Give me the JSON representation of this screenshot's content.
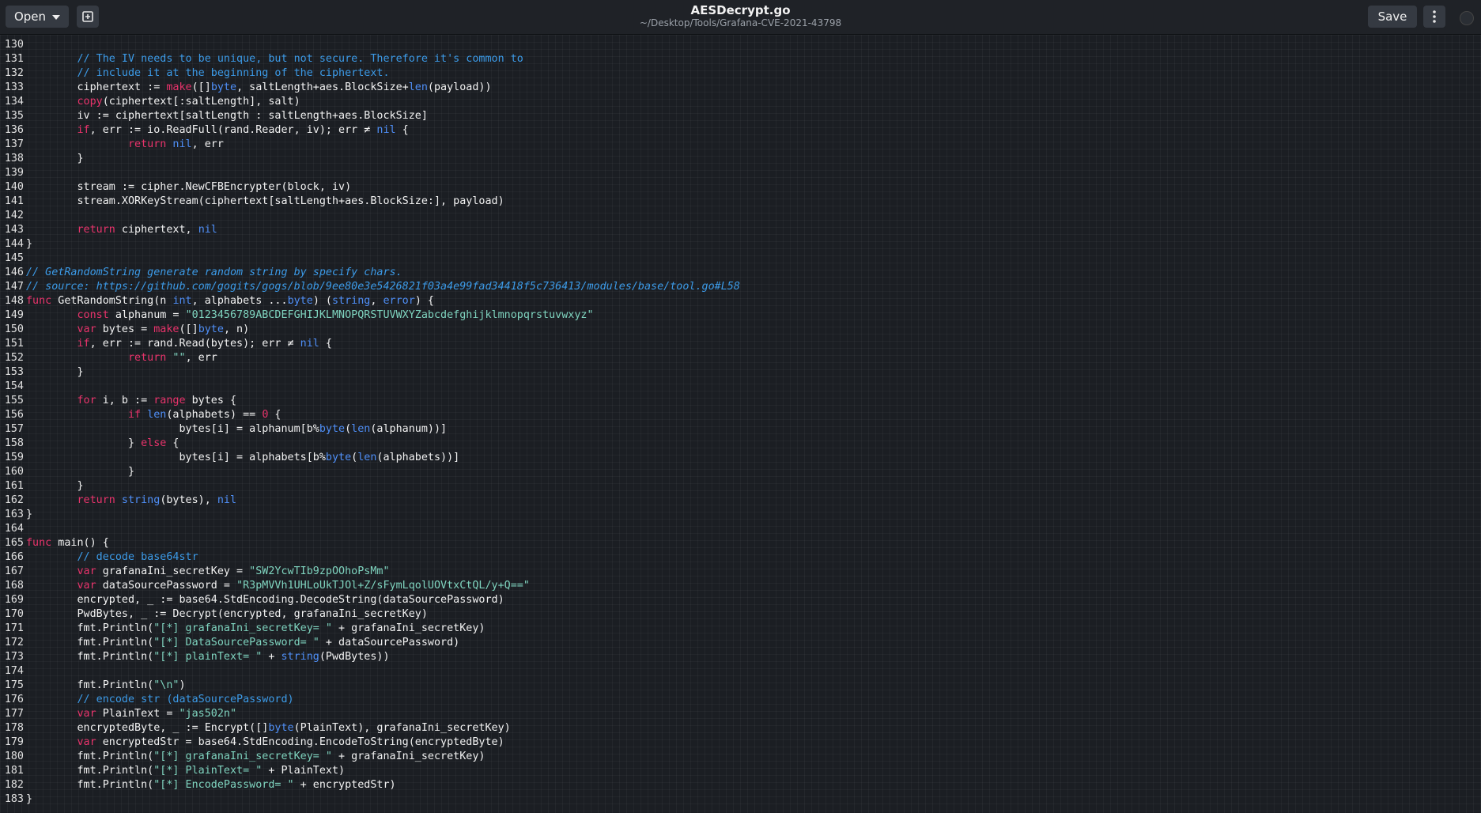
{
  "header": {
    "open_label": "Open",
    "title": "AESDecrypt.go",
    "path": "~/Desktop/Tools/Grafana-CVE-2021-43798",
    "save_label": "Save"
  },
  "icons": {
    "new_document": "new-document-icon",
    "menu": "vertical-ellipsis-icon",
    "dropdown": "chevron-down-icon"
  },
  "colors": {
    "background": "#1b1e23",
    "keyword": "#e8336b",
    "type": "#4f8ff7",
    "string": "#7fd4bf",
    "comment": "#3c9be8"
  },
  "code_lines": [
    {
      "n": "130",
      "t": []
    },
    {
      "n": "131",
      "t": [
        [
          "cm",
          "\t// The IV needs to be unique, but not secure. Therefore it's common to"
        ]
      ]
    },
    {
      "n": "132",
      "t": [
        [
          "cm",
          "\t// include it at the beginning of the ciphertext."
        ]
      ]
    },
    {
      "n": "133",
      "t": [
        [
          "",
          "\tciphertext := "
        ],
        [
          "fn",
          "make"
        ],
        [
          "",
          "([]"
        ],
        [
          "ty",
          "byte"
        ],
        [
          "",
          ", saltLength+aes.BlockSize+"
        ],
        [
          "ty",
          "len"
        ],
        [
          "",
          "(payload))"
        ]
      ]
    },
    {
      "n": "134",
      "t": [
        [
          "",
          "\t"
        ],
        [
          "fn",
          "copy"
        ],
        [
          "",
          "(ciphertext[:saltLength], salt)"
        ]
      ]
    },
    {
      "n": "135",
      "t": [
        [
          "",
          "\tiv := ciphertext[saltLength : saltLength+aes.BlockSize]"
        ]
      ]
    },
    {
      "n": "136",
      "t": [
        [
          "kw",
          "\tif"
        ],
        [
          "",
          ", err := io.ReadFull(rand.Reader, iv); err ≠ "
        ],
        [
          "ty",
          "nil"
        ],
        [
          "",
          " {"
        ]
      ]
    },
    {
      "n": "137",
      "t": [
        [
          "kw",
          "\t\treturn"
        ],
        [
          "ty",
          " nil"
        ],
        [
          "",
          ", err"
        ]
      ]
    },
    {
      "n": "138",
      "t": [
        [
          "",
          "\t}"
        ]
      ]
    },
    {
      "n": "139",
      "t": []
    },
    {
      "n": "140",
      "t": [
        [
          "",
          "\tstream := cipher.NewCFBEncrypter(block, iv)"
        ]
      ]
    },
    {
      "n": "141",
      "t": [
        [
          "",
          "\tstream.XORKeyStream(ciphertext[saltLength+aes.BlockSize:], payload)"
        ]
      ]
    },
    {
      "n": "142",
      "t": []
    },
    {
      "n": "143",
      "t": [
        [
          "kw",
          "\treturn"
        ],
        [
          "",
          " ciphertext, "
        ],
        [
          "ty",
          "nil"
        ]
      ]
    },
    {
      "n": "144",
      "t": [
        [
          "",
          "}"
        ]
      ]
    },
    {
      "n": "145",
      "t": []
    },
    {
      "n": "146",
      "t": [
        [
          "url",
          "// GetRandomString generate random string by specify chars."
        ]
      ]
    },
    {
      "n": "147",
      "t": [
        [
          "url",
          "// source: https://github.com/gogits/gogs/blob/9ee80e3e5426821f03a4e99fad34418f5c736413/modules/base/tool.go#L58"
        ]
      ]
    },
    {
      "n": "148",
      "t": [
        [
          "kw",
          "func"
        ],
        [
          "",
          " GetRandomString(n "
        ],
        [
          "ty",
          "int"
        ],
        [
          "",
          ", alphabets ..."
        ],
        [
          "ty",
          "byte"
        ],
        [
          "",
          ") ("
        ],
        [
          "ty",
          "string"
        ],
        [
          "",
          ", "
        ],
        [
          "ty",
          "error"
        ],
        [
          "",
          ") {"
        ]
      ]
    },
    {
      "n": "149",
      "t": [
        [
          "kw",
          "\tconst"
        ],
        [
          "",
          " alphanum = "
        ],
        [
          "str",
          "\"0123456789ABCDEFGHIJKLMNOPQRSTUVWXYZabcdefghijklmnopqrstuvwxyz\""
        ]
      ]
    },
    {
      "n": "150",
      "t": [
        [
          "kw",
          "\tvar"
        ],
        [
          "",
          " bytes = "
        ],
        [
          "fn",
          "make"
        ],
        [
          "",
          "([]"
        ],
        [
          "ty",
          "byte"
        ],
        [
          "",
          ", n)"
        ]
      ]
    },
    {
      "n": "151",
      "t": [
        [
          "kw",
          "\tif"
        ],
        [
          "",
          ", err := rand.Read(bytes); err ≠ "
        ],
        [
          "ty",
          "nil"
        ],
        [
          "",
          " {"
        ]
      ]
    },
    {
      "n": "152",
      "t": [
        [
          "kw",
          "\t\treturn"
        ],
        [
          "str",
          " \"\""
        ],
        [
          "",
          ", err"
        ]
      ]
    },
    {
      "n": "153",
      "t": [
        [
          "",
          "\t}"
        ]
      ]
    },
    {
      "n": "154",
      "t": []
    },
    {
      "n": "155",
      "t": [
        [
          "kw",
          "\tfor"
        ],
        [
          "",
          " i, b := "
        ],
        [
          "kw",
          "range"
        ],
        [
          "",
          " bytes {"
        ]
      ]
    },
    {
      "n": "156",
      "t": [
        [
          "kw",
          "\t\tif"
        ],
        [
          "ty",
          " len"
        ],
        [
          "",
          "(alphabets) == "
        ],
        [
          "kw",
          "0"
        ],
        [
          "",
          " {"
        ]
      ]
    },
    {
      "n": "157",
      "t": [
        [
          "",
          "\t\t\tbytes[i] = alphanum[b%"
        ],
        [
          "ty",
          "byte"
        ],
        [
          "",
          "("
        ],
        [
          "ty",
          "len"
        ],
        [
          "",
          "(alphanum))]"
        ]
      ]
    },
    {
      "n": "158",
      "t": [
        [
          "",
          "\t\t} "
        ],
        [
          "kw",
          "else"
        ],
        [
          "",
          " {"
        ]
      ]
    },
    {
      "n": "159",
      "t": [
        [
          "",
          "\t\t\tbytes[i] = alphabets[b%"
        ],
        [
          "ty",
          "byte"
        ],
        [
          "",
          "("
        ],
        [
          "ty",
          "len"
        ],
        [
          "",
          "(alphabets))]"
        ]
      ]
    },
    {
      "n": "160",
      "t": [
        [
          "",
          "\t\t}"
        ]
      ]
    },
    {
      "n": "161",
      "t": [
        [
          "",
          "\t}"
        ]
      ]
    },
    {
      "n": "162",
      "t": [
        [
          "kw",
          "\treturn"
        ],
        [
          "ty",
          " string"
        ],
        [
          "",
          "(bytes), "
        ],
        [
          "ty",
          "nil"
        ]
      ]
    },
    {
      "n": "163",
      "t": [
        [
          "",
          "}"
        ]
      ]
    },
    {
      "n": "164",
      "t": []
    },
    {
      "n": "165",
      "t": [
        [
          "kw",
          "func"
        ],
        [
          "",
          " main() {"
        ]
      ]
    },
    {
      "n": "166",
      "t": [
        [
          "cm",
          "\t// decode base64str"
        ]
      ]
    },
    {
      "n": "167",
      "t": [
        [
          "kw",
          "\tvar"
        ],
        [
          "",
          " grafanaIni_secretKey = "
        ],
        [
          "str",
          "\"SW2YcwTIb9zpOOhoPsMm\""
        ]
      ]
    },
    {
      "n": "168",
      "t": [
        [
          "kw",
          "\tvar"
        ],
        [
          "",
          " dataSourcePassword = "
        ],
        [
          "str",
          "\"R3pMVVh1UHLoUkTJOl+Z/sFymLqolUOVtxCtQL/y+Q==\""
        ]
      ]
    },
    {
      "n": "169",
      "t": [
        [
          "",
          "\tencrypted, _ := base64.StdEncoding.DecodeString(dataSourcePassword)"
        ]
      ]
    },
    {
      "n": "170",
      "t": [
        [
          "",
          "\tPwdBytes, _ := Decrypt(encrypted, grafanaIni_secretKey)"
        ]
      ]
    },
    {
      "n": "171",
      "t": [
        [
          "",
          "\tfmt.Println("
        ],
        [
          "str",
          "\"[*] grafanaIni_secretKey= \""
        ],
        [
          "",
          " + grafanaIni_secretKey)"
        ]
      ]
    },
    {
      "n": "172",
      "t": [
        [
          "",
          "\tfmt.Println("
        ],
        [
          "str",
          "\"[*] DataSourcePassword= \""
        ],
        [
          "",
          " + dataSourcePassword)"
        ]
      ]
    },
    {
      "n": "173",
      "t": [
        [
          "",
          "\tfmt.Println("
        ],
        [
          "str",
          "\"[*] plainText= \""
        ],
        [
          "",
          " + "
        ],
        [
          "ty",
          "string"
        ],
        [
          "",
          "(PwdBytes))"
        ]
      ]
    },
    {
      "n": "174",
      "t": []
    },
    {
      "n": "175",
      "t": [
        [
          "",
          "\tfmt.Println("
        ],
        [
          "str",
          "\"\\n\""
        ],
        [
          "",
          ")"
        ]
      ]
    },
    {
      "n": "176",
      "t": [
        [
          "cm",
          "\t// encode str (dataSourcePassword)"
        ]
      ]
    },
    {
      "n": "177",
      "t": [
        [
          "kw",
          "\tvar"
        ],
        [
          "",
          " PlainText = "
        ],
        [
          "str",
          "\"jas502n\""
        ]
      ]
    },
    {
      "n": "178",
      "t": [
        [
          "",
          "\tencryptedByte, _ := Encrypt([]"
        ],
        [
          "ty",
          "byte"
        ],
        [
          "",
          "(PlainText), grafanaIni_secretKey)"
        ]
      ]
    },
    {
      "n": "179",
      "t": [
        [
          "kw",
          "\tvar"
        ],
        [
          "",
          " encryptedStr = base64.StdEncoding.EncodeToString(encryptedByte)"
        ]
      ]
    },
    {
      "n": "180",
      "t": [
        [
          "",
          "\tfmt.Println("
        ],
        [
          "str",
          "\"[*] grafanaIni_secretKey= \""
        ],
        [
          "",
          " + grafanaIni_secretKey)"
        ]
      ]
    },
    {
      "n": "181",
      "t": [
        [
          "",
          "\tfmt.Println("
        ],
        [
          "str",
          "\"[*] PlainText= \""
        ],
        [
          "",
          " + PlainText)"
        ]
      ]
    },
    {
      "n": "182",
      "t": [
        [
          "",
          "\tfmt.Println("
        ],
        [
          "str",
          "\"[*] EncodePassword= \""
        ],
        [
          "",
          " + encryptedStr)"
        ]
      ]
    },
    {
      "n": "183",
      "t": [
        [
          "",
          "}"
        ]
      ]
    }
  ]
}
